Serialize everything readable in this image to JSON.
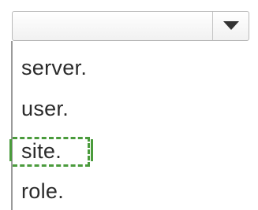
{
  "dropdown": {
    "selected_value": "",
    "options": [
      "server.",
      "user.",
      "site.",
      "role."
    ],
    "focused_index": 2
  },
  "colors": {
    "focus_outline": "#4a9b3c",
    "text": "#2b2b2b",
    "border": "#b9b9b9"
  }
}
